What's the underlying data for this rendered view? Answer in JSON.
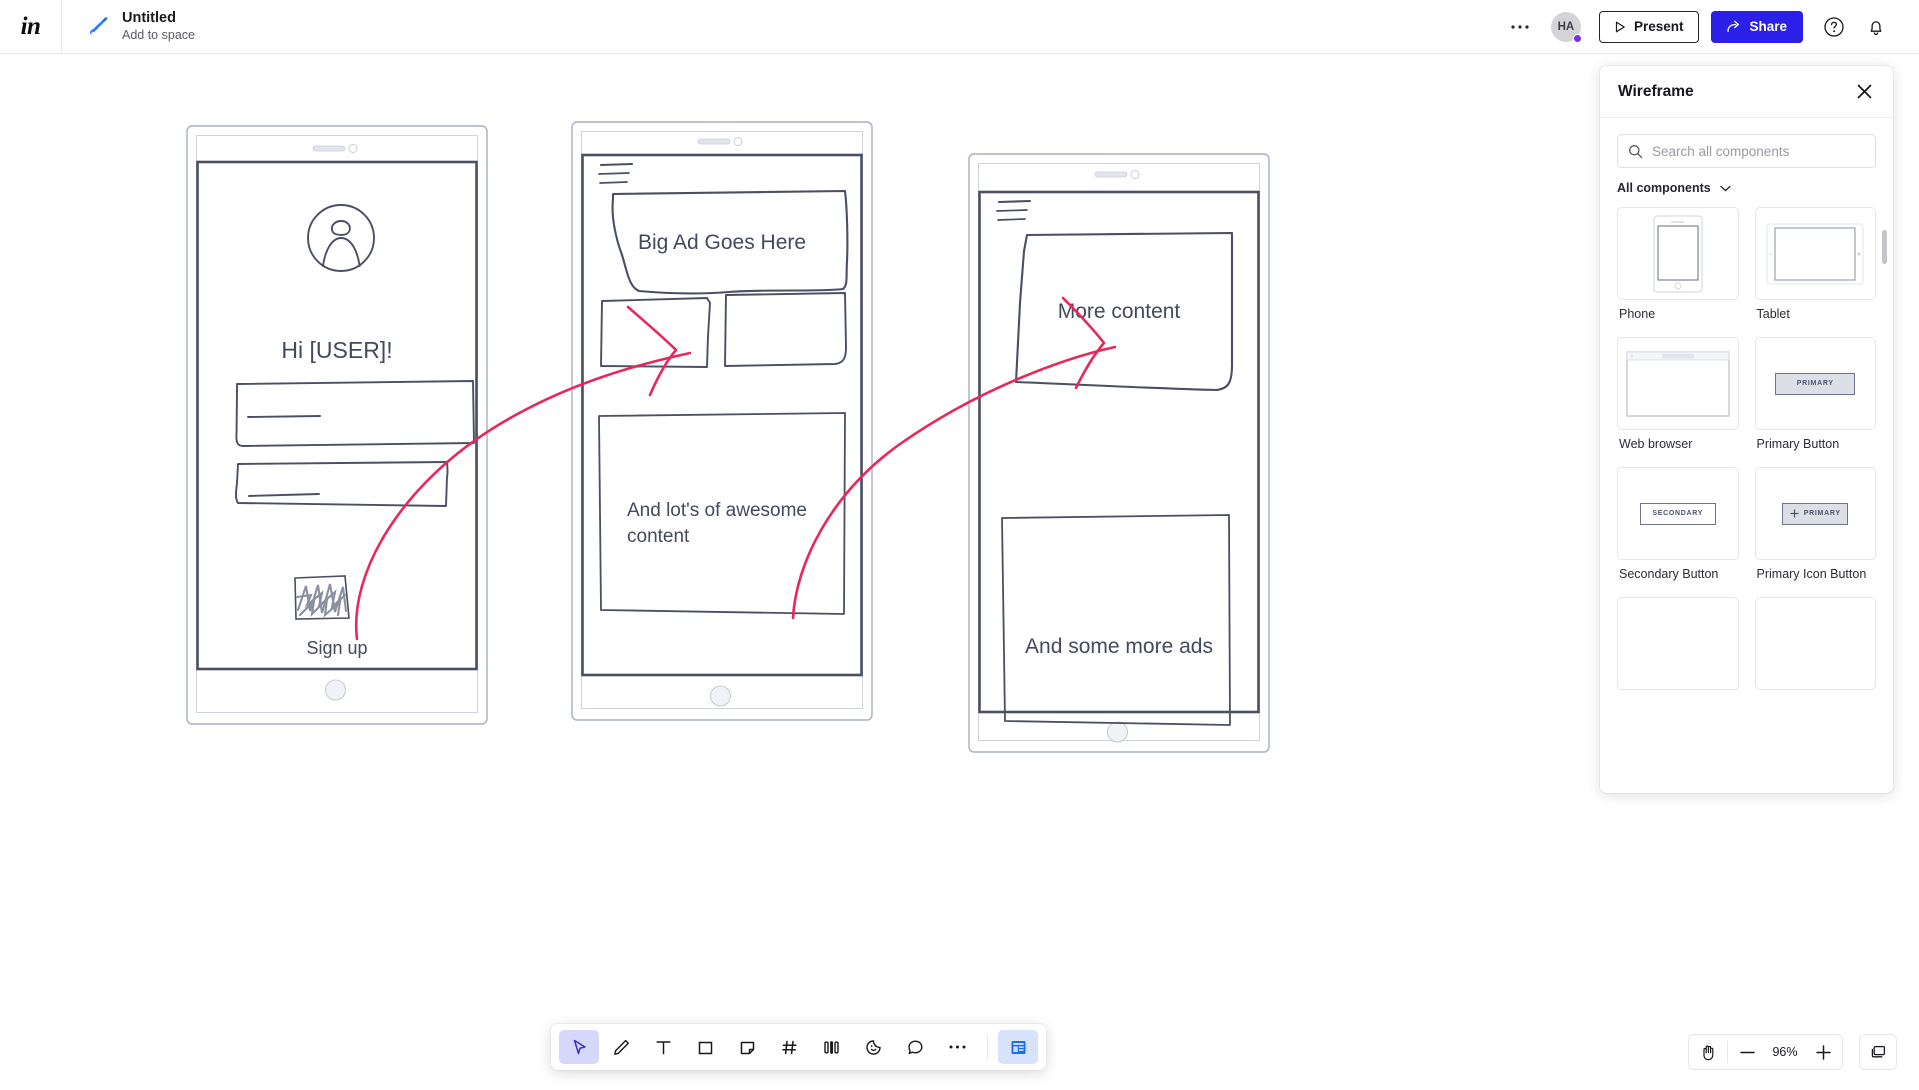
{
  "header": {
    "logo": "in",
    "doc_title": "Untitled",
    "doc_subtitle": "Add to space",
    "more_label": "•••",
    "avatar_initials": "HA",
    "present_label": "Present",
    "share_label": "Share"
  },
  "panel": {
    "title": "Wireframe",
    "search_placeholder": "Search all components",
    "search_value": "",
    "filter_label": "All components",
    "components": [
      {
        "label": "Phone",
        "thumb": "phone"
      },
      {
        "label": "Tablet",
        "thumb": "tablet"
      },
      {
        "label": "Web browser",
        "thumb": "browser"
      },
      {
        "label": "Primary Button",
        "thumb": "primary-button",
        "button_text": "PRIMARY"
      },
      {
        "label": "Secondary Button",
        "thumb": "secondary-button",
        "button_text": "SECONDARY"
      },
      {
        "label": "Primary Icon Button",
        "thumb": "primary-icon-button",
        "button_text": "PRIMARY"
      }
    ]
  },
  "canvas": {
    "screen1": {
      "greeting": "Hi  [USER]!",
      "cta_label": "Sign up"
    },
    "screen2": {
      "ad_text": "Big Ad Goes Here",
      "content_text": "And lot's of awesome content"
    },
    "screen3": {
      "heading": "More content",
      "ad_text": "And some more ads"
    },
    "accent_connector_color": "#e8275a",
    "sketch_color": "#4a4f63"
  },
  "toolbar": {
    "tools": [
      {
        "name": "select",
        "label": "Select"
      },
      {
        "name": "pencil",
        "label": "Pencil"
      },
      {
        "name": "text",
        "label": "Text"
      },
      {
        "name": "rectangle",
        "label": "Shape"
      },
      {
        "name": "sticky-note",
        "label": "Sticky note"
      },
      {
        "name": "grid",
        "label": "Frame"
      },
      {
        "name": "columns",
        "label": "Layout"
      },
      {
        "name": "sticker",
        "label": "Sticker"
      },
      {
        "name": "comment",
        "label": "Comment"
      },
      {
        "name": "more",
        "label": "More"
      }
    ],
    "library_label": "Components library"
  },
  "zoom": {
    "hand_label": "Pan",
    "minus_label": "Zoom out",
    "level": "96%",
    "plus_label": "Zoom in",
    "pages_label": "Pages"
  }
}
